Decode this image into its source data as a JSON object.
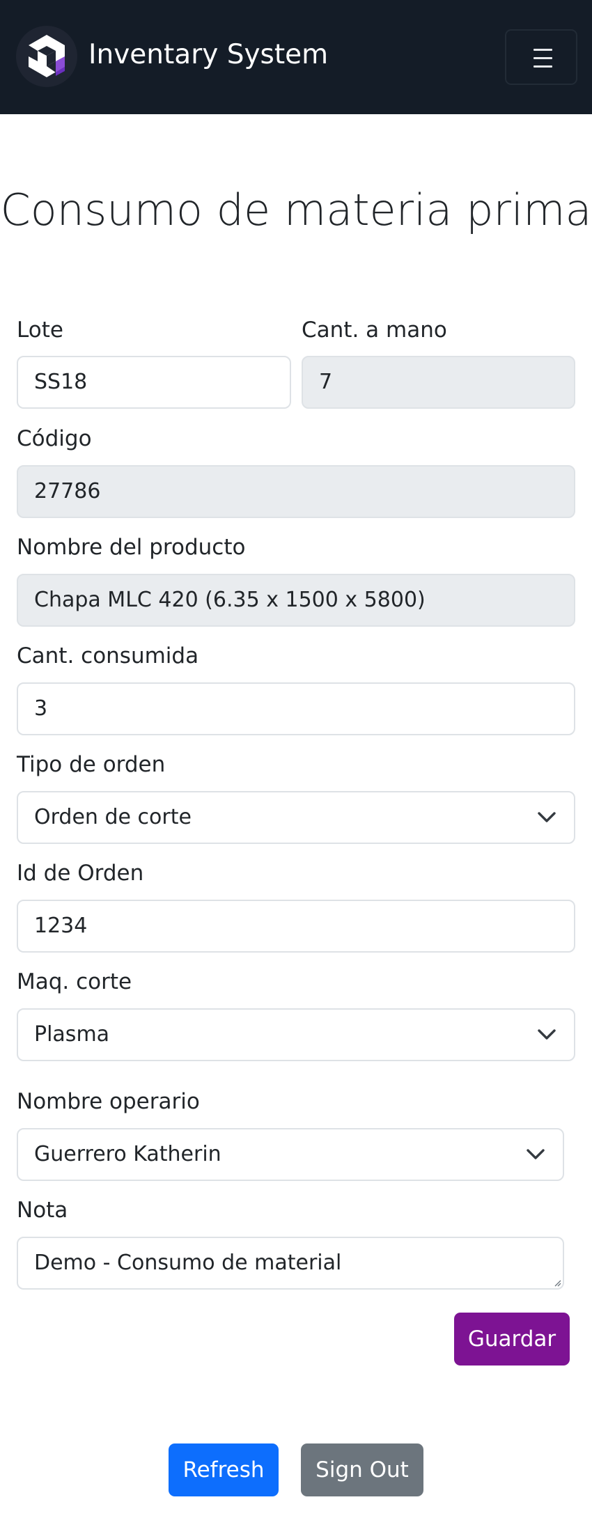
{
  "navbar": {
    "brand": "Inventary System",
    "logo_icon": "cube-logo-icon",
    "menu_icon": "hamburger-menu-icon"
  },
  "page_title": "Consumo de materia prima",
  "form": {
    "lote": {
      "label": "Lote",
      "value": "SS18"
    },
    "cant_mano": {
      "label": "Cant. a mano",
      "value": "7"
    },
    "codigo": {
      "label": "Código",
      "value": "27786"
    },
    "nombre_producto": {
      "label": "Nombre del producto",
      "value": "Chapa MLC 420 (6.35 x 1500 x 5800)"
    },
    "cant_consumida": {
      "label": "Cant. consumida",
      "value": "3"
    },
    "tipo_orden": {
      "label": "Tipo de orden",
      "selected": "Orden de corte"
    },
    "id_orden": {
      "label": "Id de Orden",
      "value": "1234"
    },
    "maq_corte": {
      "label": "Maq. corte",
      "selected": "Plasma"
    },
    "nombre_operario": {
      "label": "Nombre operario",
      "selected": "Guerrero Katherin"
    },
    "nota": {
      "label": "Nota",
      "value": "Demo -  Consumo de material"
    },
    "save_label": "Guardar"
  },
  "footer": {
    "refresh_label": "Refresh",
    "signout_label": "Sign Out"
  },
  "colors": {
    "navbar_bg": "#141c27",
    "save_button": "#7d1393",
    "refresh_button": "#0d6efd",
    "signout_button": "#6c757d",
    "readonly_field_bg": "#e9ecef"
  }
}
